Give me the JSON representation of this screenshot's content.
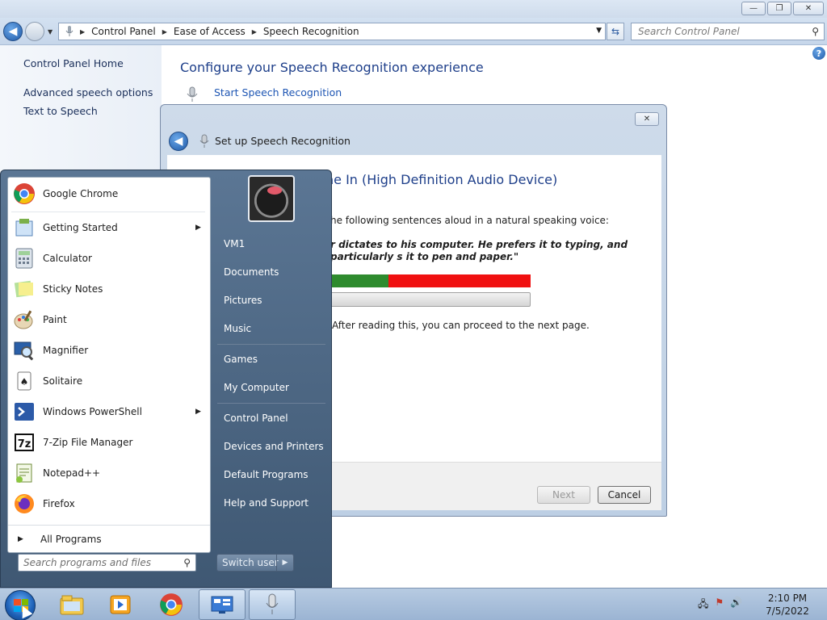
{
  "window": {
    "minimize": "—",
    "maximize": "❐",
    "close": "✕"
  },
  "address": {
    "breadcrumbs": [
      "Control Panel",
      "Ease of Access",
      "Speech Recognition"
    ],
    "search_placeholder": "Search Control Panel"
  },
  "left_pane": {
    "links": [
      "Control Panel Home",
      "Advanced speech options",
      "Text to Speech"
    ]
  },
  "main": {
    "heading": "Configure your Speech Recognition experience",
    "start_link": "Start Speech Recognition"
  },
  "dialog": {
    "title": "Set up Speech Recognition",
    "mic_heading": "ne In (High Definition Audio Device)",
    "instruction": "he following sentences aloud in a natural speaking voice:",
    "sentence": "r dictates to his computer. He prefers it to typing, and particularly s it to pen and paper.\"",
    "after_text": "After reading this, you can proceed to the next page.",
    "next_label": "Next",
    "cancel_label": "Cancel",
    "level_green_fraction": 0.29,
    "level_colors": {
      "good": "#2e8b2e",
      "high": "#f01010"
    }
  },
  "start_menu": {
    "programs": [
      {
        "label": "Google Chrome",
        "icon": "chrome-icon",
        "submenu": false
      },
      {
        "label": "Getting Started",
        "icon": "getting-started-icon",
        "submenu": true
      },
      {
        "label": "Calculator",
        "icon": "calculator-icon",
        "submenu": false
      },
      {
        "label": "Sticky Notes",
        "icon": "sticky-notes-icon",
        "submenu": false
      },
      {
        "label": "Paint",
        "icon": "paint-icon",
        "submenu": false
      },
      {
        "label": "Magnifier",
        "icon": "magnifier-icon",
        "submenu": false
      },
      {
        "label": "Solitaire",
        "icon": "solitaire-icon",
        "submenu": false
      },
      {
        "label": "Windows PowerShell",
        "icon": "powershell-icon",
        "submenu": true
      },
      {
        "label": "7-Zip File Manager",
        "icon": "7zip-icon",
        "submenu": false
      },
      {
        "label": "Notepad++",
        "icon": "notepadpp-icon",
        "submenu": false
      },
      {
        "label": "Firefox",
        "icon": "firefox-icon",
        "submenu": false
      }
    ],
    "all_programs": "All Programs",
    "search_placeholder": "Search programs and files",
    "right_items": [
      "VM1",
      "Documents",
      "Pictures",
      "Music",
      "Games",
      "My Computer",
      "Control Panel",
      "Devices and Printers",
      "Default Programs",
      "Help and Support"
    ],
    "switch_user": "Switch user"
  },
  "taskbar": {
    "apps": [
      "explorer-icon",
      "media-player-icon",
      "chrome-icon",
      "control-panel-icon",
      "speech-recognition-icon"
    ],
    "time": "2:10 PM",
    "date": "7/5/2022"
  }
}
